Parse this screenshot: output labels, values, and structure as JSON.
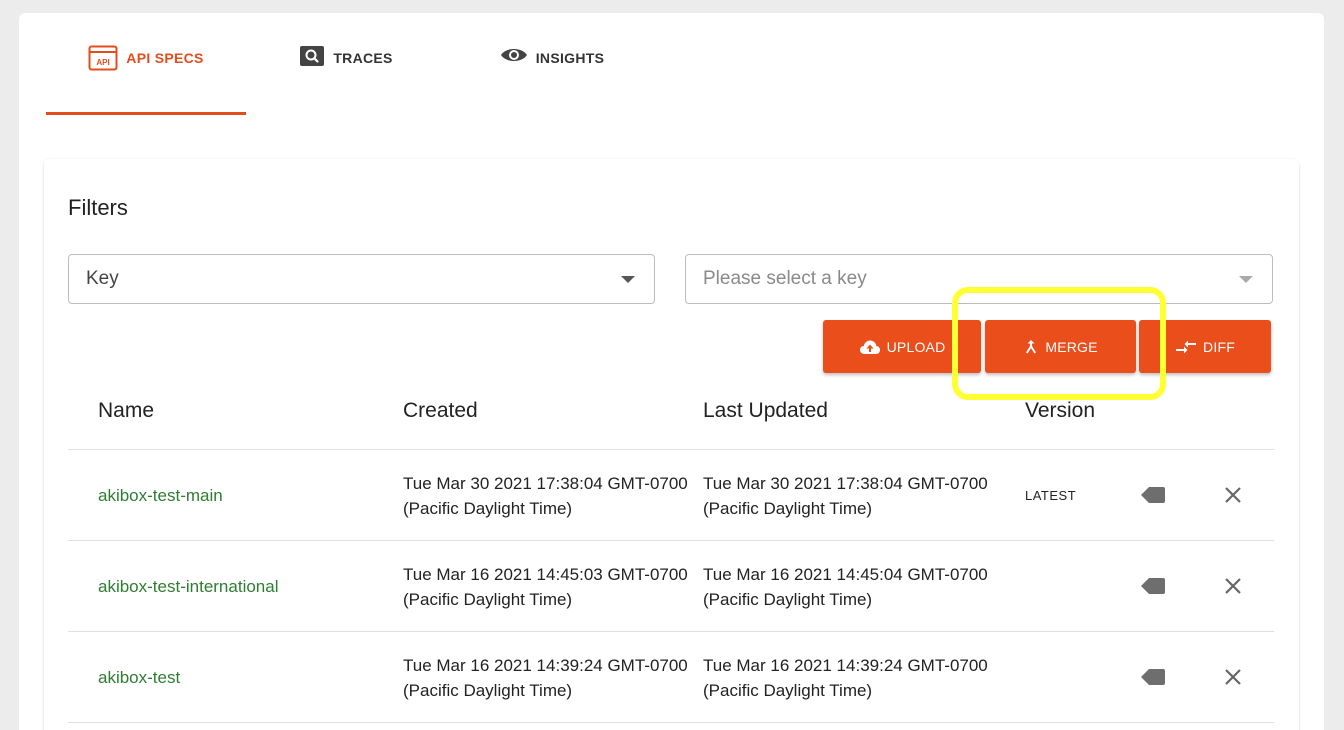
{
  "tabs": [
    {
      "label": "API SPECS",
      "icon": "api-icon",
      "active": true
    },
    {
      "label": "TRACES",
      "icon": "search-icon",
      "active": false
    },
    {
      "label": "INSIGHTS",
      "icon": "eye-icon",
      "active": false
    }
  ],
  "colors": {
    "accent": "#e94e1b",
    "link": "#2e7d32",
    "highlight": "#ffff33"
  },
  "filters": {
    "title": "Filters",
    "key_select": {
      "value": "Key"
    },
    "value_select": {
      "placeholder": "Please select a key"
    }
  },
  "actions": {
    "upload_label": "UPLOAD",
    "merge_label": "MERGE",
    "diff_label": "DIFF"
  },
  "table": {
    "headers": {
      "name": "Name",
      "created": "Created",
      "updated": "Last Updated",
      "version": "Version"
    },
    "rows": [
      {
        "name": "akibox-test-main",
        "created": "Tue Mar 30 2021 17:38:04 GMT-0700 (Pacific Daylight Time)",
        "updated": "Tue Mar 30 2021 17:38:04 GMT-0700 (Pacific Daylight Time)",
        "version": "LATEST"
      },
      {
        "name": "akibox-test-international",
        "created": "Tue Mar 16 2021 14:45:03 GMT-0700 (Pacific Daylight Time)",
        "updated": "Tue Mar 16 2021 14:45:04 GMT-0700 (Pacific Daylight Time)",
        "version": ""
      },
      {
        "name": "akibox-test",
        "created": "Tue Mar 16 2021 14:39:24 GMT-0700 (Pacific Daylight Time)",
        "updated": "Tue Mar 16 2021 14:39:24 GMT-0700 (Pacific Daylight Time)",
        "version": ""
      }
    ]
  }
}
